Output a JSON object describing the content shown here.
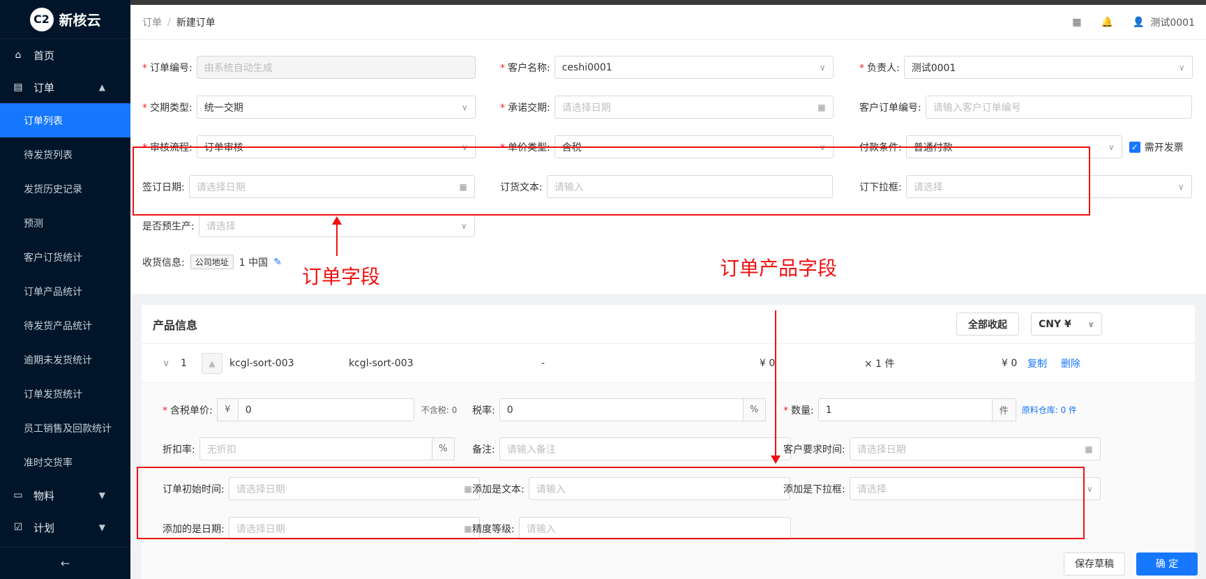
{
  "app": {
    "logo_text": "新核云",
    "logo_mark": "C2"
  },
  "sidebar": {
    "home": "首页",
    "order": "订单",
    "order_subitems": [
      "订单列表",
      "待发货列表",
      "发货历史记录",
      "预测",
      "客户订货统计",
      "订单产品统计",
      "待发货产品统计",
      "逾期未发货统计",
      "订单发货统计",
      "员工销售及回款统计",
      "准时交货率"
    ],
    "material": "物料",
    "plan": "计划",
    "collapse": "←"
  },
  "header": {
    "breadcrumb_root": "订单",
    "breadcrumb_sep": "/",
    "breadcrumb_current": "新建订单",
    "user_name": "测试0001"
  },
  "form": {
    "order_no_label": "订单编号:",
    "order_no_placeholder": "由系统自动生成",
    "customer_label": "客户名称:",
    "customer_value": "ceshi0001",
    "owner_label": "负责人:",
    "owner_value": "测试0001",
    "delivery_type_label": "交期类型:",
    "delivery_type_value": "统一交期",
    "promised_date_label": "承诺交期:",
    "promised_date_placeholder": "请选择日期",
    "customer_order_no_label": "客户订单编号:",
    "customer_order_no_placeholder": "请输入客户订单编号",
    "review_flow_label": "审核流程:",
    "review_flow_value": "订单审核",
    "price_type_label": "单价类型:",
    "price_type_value": "含税",
    "payment_label": "付款条件:",
    "payment_value": "普通付款",
    "invoice_label": "需开发票",
    "sign_date_label": "签订日期:",
    "sign_date_placeholder": "请选择日期",
    "order_text_label": "订货文本:",
    "order_text_placeholder": "请输入",
    "order_dropdown_label": "订下拉框:",
    "order_dropdown_placeholder": "请选择",
    "preproduce_label": "是否预生产:",
    "preproduce_placeholder": "请选择",
    "shipping_label": "收货信息:",
    "shipping_tag": "公司地址",
    "shipping_value": "1 中国"
  },
  "annotations": {
    "order_fields": "订单字段",
    "product_fields": "订单产品字段"
  },
  "product": {
    "title": "产品信息",
    "collapse_all": "全部收起",
    "currency": "CNY ¥",
    "row": {
      "index": "1",
      "code": "kcgl-sort-003",
      "name": "kcgl-sort-003",
      "spec": "-",
      "price": "¥ 0",
      "qty": "× 1 件",
      "amount": "¥ 0",
      "copy": "复制",
      "delete": "删除"
    },
    "unit_price_label": "含税单价:",
    "unit_price_prefix": "¥",
    "unit_price_value": "0",
    "untaxed": "不含税: 0",
    "tax_rate_label": "税率:",
    "tax_rate_value": "0",
    "tax_rate_suffix": "%",
    "qty_label": "数量:",
    "qty_value": "1",
    "qty_unit": "件",
    "warehouse": "原料仓库: 0 件",
    "discount_label": "折扣率:",
    "discount_placeholder": "无折扣",
    "discount_suffix": "%",
    "remark_label": "备注:",
    "remark_placeholder": "请输入备注",
    "cust_time_label": "客户要求时间:",
    "cust_time_placeholder": "请选择日期",
    "start_time_label": "订单初始时间:",
    "start_time_placeholder": "请选择日期",
    "add_text_label": "添加是文本:",
    "add_text_placeholder": "请输入",
    "add_dropdown_label": "添加是下拉框:",
    "add_dropdown_placeholder": "请选择",
    "add_date_label": "添加的是日期:",
    "add_date_placeholder": "请选择日期",
    "precision_label": "精度等级:",
    "precision_placeholder": "请输入"
  },
  "footer": {
    "save_draft": "保存草稿",
    "confirm": "确 定"
  }
}
